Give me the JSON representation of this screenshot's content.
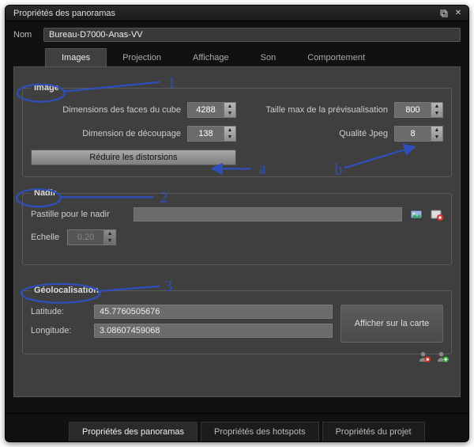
{
  "titlebar": {
    "title": "Propriétés des panoramas"
  },
  "name": {
    "label": "Nom",
    "value": "Bureau-D7000-Anas-VV"
  },
  "tabs": [
    "Images",
    "Projection",
    "Affichage",
    "Son",
    "Comportement"
  ],
  "active_tab": 0,
  "image": {
    "legend": "Image",
    "cube_label": "Dimensions des faces du cube",
    "cube_value": "4288",
    "split_label": "Dimension de découpage",
    "split_value": "138",
    "preview_label": "Taille max de la prévisualisation",
    "preview_value": "800",
    "jpeg_label": "Qualité Jpeg",
    "jpeg_value": "8",
    "reduce_btn": "Réduire les distorsions"
  },
  "nadir": {
    "legend": "Nadir",
    "patch_label": "Pastille pour le nadir",
    "scale_label": "Echelle",
    "scale_value": "0.20"
  },
  "geo": {
    "legend": "Géolocalisation",
    "lat_label": "Latitude:",
    "lat_value": "45.7760505676",
    "lon_label": "Longitude:",
    "lon_value": "3.08607459068",
    "map_btn": "Afficher sur la carte"
  },
  "bottom_tabs": [
    "Propriétés des panoramas",
    "Propriétés des hotspots",
    "Propriétés du projet"
  ],
  "active_bottom_tab": 0,
  "annotations": {
    "n1": "1",
    "n2": "2",
    "n3": "3",
    "a": "a",
    "b": "b"
  }
}
